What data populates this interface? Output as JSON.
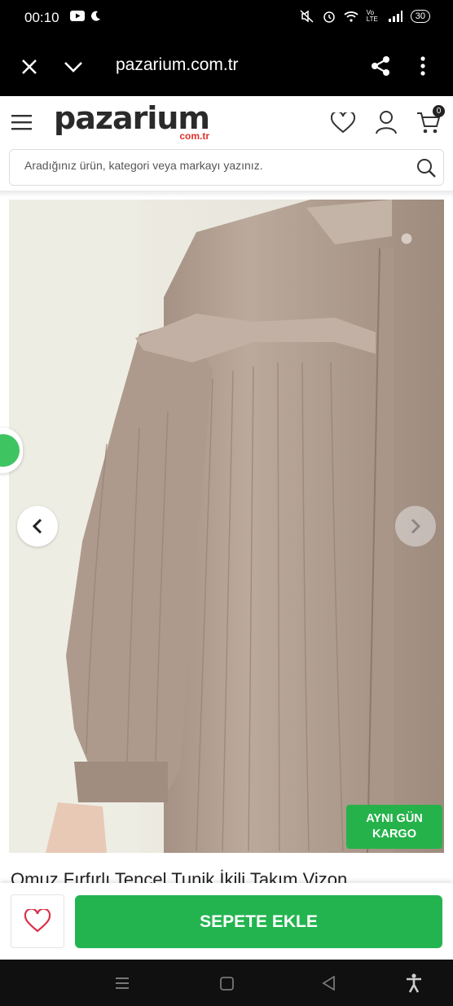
{
  "status_bar": {
    "time": "00:10",
    "network_label": "Vo LTE",
    "battery": "30"
  },
  "browser": {
    "url": "pazarium.com.tr"
  },
  "header": {
    "logo_main": "pazarium",
    "logo_sub": "com.tr",
    "cart_count": "0"
  },
  "search": {
    "placeholder": "Aradığınız ürün, kategori veya markayı yazınız."
  },
  "product": {
    "badge_line1": "AYNI GÜN",
    "badge_line2": "KARGO",
    "title": "Omuz Fırfırlı Tencel Tunik İkili Takım Vizon"
  },
  "actions": {
    "add_to_cart": "SEPETE EKLE"
  },
  "colors": {
    "brand_red": "#e0312b",
    "green": "#23b450",
    "fabric": "#b3a195"
  }
}
